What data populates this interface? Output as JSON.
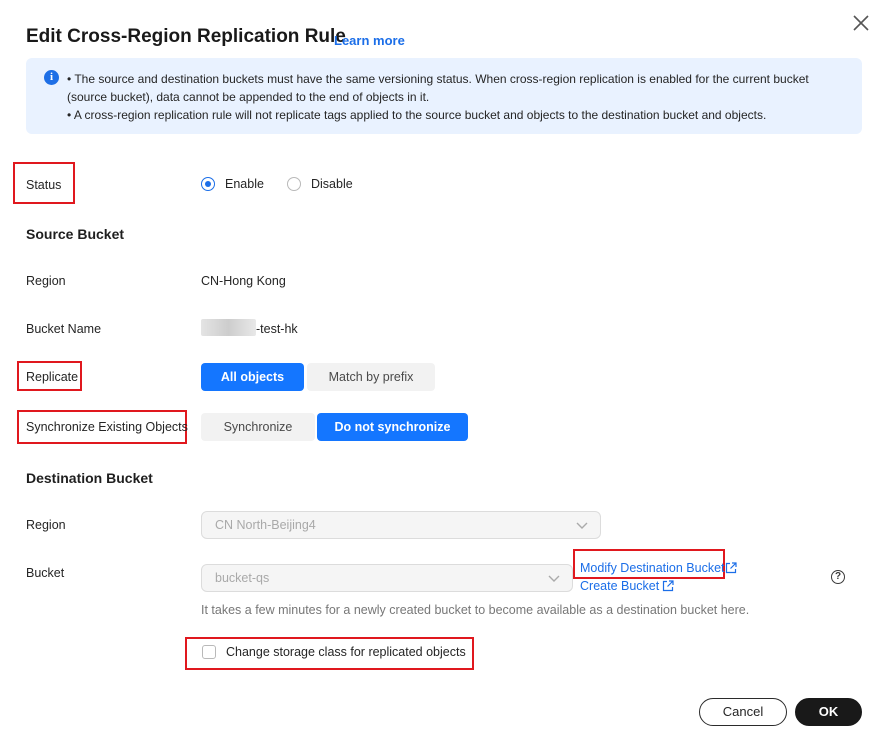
{
  "dialog": {
    "title": "Edit Cross-Region Replication Rule",
    "learn_more": "Learn more"
  },
  "notice": {
    "line1": "• The source and destination buckets must have the same versioning status. When cross-region replication is enabled for the current bucket (source bucket), data cannot be appended to the end of objects in it.",
    "line2": "• A cross-region replication rule will not replicate tags applied to the source bucket and objects to the destination bucket and objects."
  },
  "status": {
    "label": "Status",
    "options": [
      {
        "label": "Enable",
        "selected": true
      },
      {
        "label": "Disable",
        "selected": false
      }
    ]
  },
  "source": {
    "heading": "Source Bucket",
    "region_label": "Region",
    "region_value": "CN-Hong Kong",
    "bucket_name_label": "Bucket Name",
    "bucket_name_value": "-test-hk",
    "replicate_label": "Replicate",
    "replicate_options": [
      "All objects",
      "Match by prefix"
    ],
    "replicate_selected": "All objects",
    "sync_label": "Synchronize Existing Objects",
    "sync_options": [
      "Synchronize",
      "Do not synchronize"
    ],
    "sync_selected": "Do not synchronize"
  },
  "destination": {
    "heading": "Destination Bucket",
    "region_label": "Region",
    "region_value": "CN North-Beijing4",
    "bucket_label": "Bucket",
    "bucket_value": "bucket-qs",
    "modify_link": "Modify Destination Bucket",
    "create_link": "Create Bucket",
    "hint": "It takes a few minutes for a newly created bucket to become available as a destination bucket here.",
    "storage_class_checkbox": "Change storage class for replicated objects",
    "storage_class_checked": false
  },
  "footer": {
    "cancel": "Cancel",
    "ok": "OK"
  },
  "colors": {
    "accent": "#1476ff",
    "highlight_box": "#e0181e",
    "notice_bg": "#e9f2ff"
  }
}
